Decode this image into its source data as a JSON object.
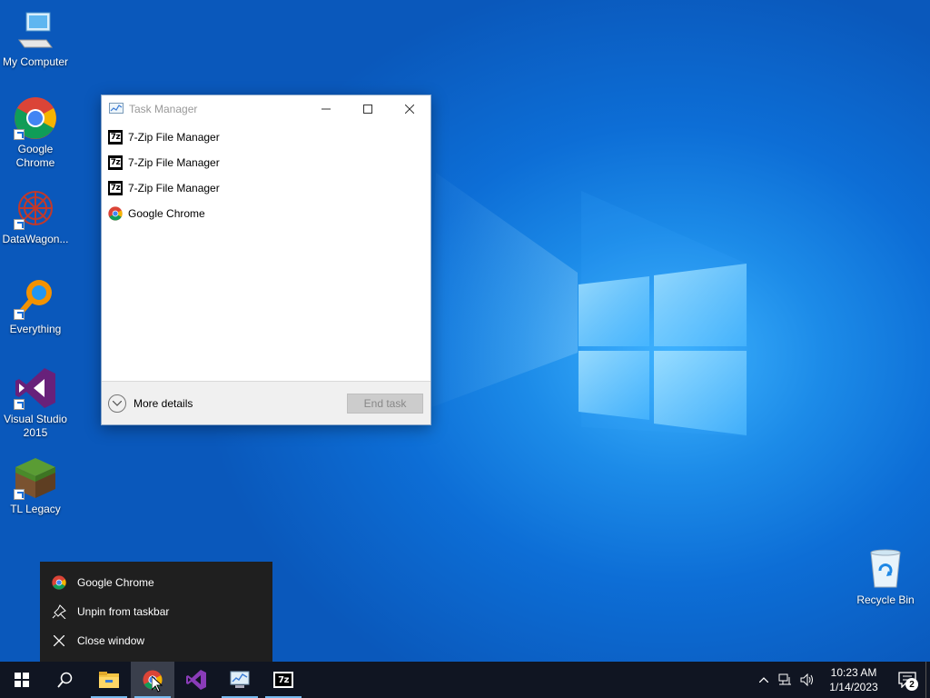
{
  "desktop": {
    "icons": [
      {
        "label": "My Computer"
      },
      {
        "label": "Google\nChrome"
      },
      {
        "label": "DataWagon..."
      },
      {
        "label": "Everything"
      },
      {
        "label": "Visual Studio\n2015"
      },
      {
        "label": "TL Legacy"
      },
      {
        "label": "Recycle Bin"
      }
    ]
  },
  "task_manager": {
    "title": "Task Manager",
    "apps": [
      {
        "name": "7-Zip File Manager",
        "icon": "7zip-icon"
      },
      {
        "name": "7-Zip File Manager",
        "icon": "7zip-icon"
      },
      {
        "name": "7-Zip File Manager",
        "icon": "7zip-icon"
      },
      {
        "name": "Google Chrome",
        "icon": "chrome-icon"
      }
    ],
    "more_details": "More details",
    "end_task": "End task"
  },
  "jump_list": {
    "items": [
      {
        "label": "Google Chrome",
        "icon": "chrome-icon"
      },
      {
        "label": "Unpin from taskbar",
        "icon": "unpin-icon"
      },
      {
        "label": "Close window",
        "icon": "close-icon"
      }
    ]
  },
  "taskbar": {
    "buttons": [
      "start-icon",
      "search-icon",
      "file-explorer-icon",
      "chrome-icon",
      "visual-studio-icon",
      "task-manager-icon",
      "7zip-icon"
    ],
    "time": "10:23 AM",
    "date": "1/14/2023",
    "notification_count": "2"
  },
  "colors": {
    "desktop_blue": "#0d6ed6",
    "taskbar": "#101522",
    "jump_list_bg": "#1f1f1f",
    "accent_underline": "#76b9ed"
  }
}
